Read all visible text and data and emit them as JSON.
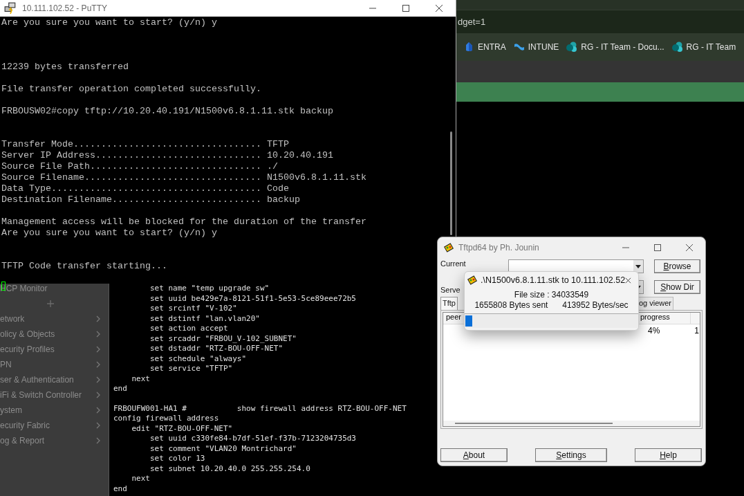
{
  "browser": {
    "address_bar": "dget=1",
    "bookmarks": [
      {
        "kind": "entra",
        "label": "ENTRA"
      },
      {
        "kind": "intune",
        "label": "INTUNE"
      },
      {
        "kind": "sharepoint",
        "label": "RG - IT Team - Docu..."
      },
      {
        "kind": "sharepoint",
        "label": "RG - IT Team"
      }
    ]
  },
  "fortigate": {
    "sidebar": [
      {
        "kind": "page",
        "label": "HCP Monitor"
      },
      {
        "kind": "add"
      },
      {
        "kind": "menu",
        "label": "etwork"
      },
      {
        "kind": "menu",
        "label": "olicy & Objects"
      },
      {
        "kind": "menu",
        "label": "ecurity Profiles"
      },
      {
        "kind": "menu",
        "label": "PN"
      },
      {
        "kind": "menu",
        "label": "ser & Authentication"
      },
      {
        "kind": "menu",
        "label": "iFi & Switch Controller"
      },
      {
        "kind": "menu",
        "label": "ystem"
      },
      {
        "kind": "menu",
        "label": "ecurity Fabric"
      },
      {
        "kind": "menu",
        "label": "og & Report"
      }
    ],
    "console": [
      [
        "        set name \"temp upgrade sw\"",
        "        set uuid be429e7a-8121-51f1-5e53-5ce89eee72b5",
        "        set srcintf \"V-102\"",
        "        set dstintf \"lan.vlan20\"",
        "        set action accept",
        "        set srcaddr \"FRBOU_V-102_SUBNET\"",
        "        set dstaddr \"RTZ-BOU-OFF-NET\"",
        "        set schedule \"always\"",
        "        set service \"TFTP\"",
        "    next",
        "end"
      ],
      [
        "FRBOUFW001-HA1 #           show firewall address RTZ-BOU-OFF-NET",
        "config firewall address",
        "    edit \"RTZ-BOU-OFF-NET\"",
        "        set uuid c330fe84-b7df-51ef-f37b-7123204735d3",
        "        set comment \"VLAN20 Montrichard\"",
        "        set color 13",
        "        set subnet 10.20.40.0 255.255.254.0",
        "    next",
        "end"
      ]
    ]
  },
  "putty": {
    "title": "10.111.102.52 - PuTTY",
    "blocks": [
      [
        "Are you sure you want to start? (y/n) y"
      ],
      [
        "12239 bytes transferred"
      ],
      [
        "File transfer operation completed successfully."
      ],
      [
        "FRBOUSW02#copy tftp://10.20.40.191/N1500v6.8.1.11.stk backup"
      ],
      [
        "Transfer Mode.................................. TFTP",
        "Server IP Address.............................. 10.20.40.191",
        "Source File Path............................... ./",
        "Source Filename................................ N1500v6.8.1.11.stk",
        "Data Type...................................... Code",
        "Destination Filename........................... backup"
      ],
      [
        "Management access will be blocked for the duration of the transfer",
        "Are you sure you want to start? (y/n) y"
      ],
      [
        "TFTP Code transfer starting..."
      ]
    ]
  },
  "tftpd": {
    "title": "Tftpd64 by Ph. Jounin",
    "fields": [
      {
        "label": "Current",
        "button": "Browse"
      },
      {
        "label": "Serve",
        "button": "Show Dir"
      }
    ],
    "tabs": [
      {
        "label": "Tftp",
        "selected": true
      },
      {
        "label": "og viewer",
        "selected": false
      }
    ],
    "columns": [
      "peer",
      "progress"
    ],
    "row": [
      "4%",
      "1"
    ],
    "buttons": [
      "About",
      "Settings",
      "Help"
    ]
  },
  "transfer_dialog": {
    "title": ".\\N1500v6.8.1.11.stk to 10.111.102.52",
    "file_size": "File size : 34033549",
    "bytes_sent": "1655808 Bytes sent",
    "rate": "413952 Bytes/sec",
    "level": 0.04
  }
}
